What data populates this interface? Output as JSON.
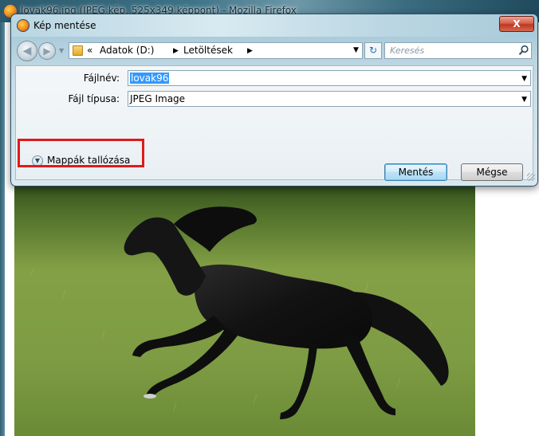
{
  "browser": {
    "title": "lovak96.jpg (JPEG kép, 525x349 képpont) - Mozilla Firefox",
    "icon": "firefox-icon"
  },
  "dialog": {
    "title": "Kép mentése",
    "close_label": "X",
    "nav": {
      "back_icon": "back-arrow-icon",
      "forward_icon": "forward-arrow-icon",
      "breadcrumb_prefix": "«",
      "breadcrumb": [
        "Adatok (D:)",
        "Letöltések"
      ],
      "refresh_icon": "refresh-icon"
    },
    "search": {
      "placeholder": "Keresés"
    },
    "form": {
      "filename_label": "Fájlnév:",
      "filename_value": "lovak96",
      "filetype_label": "Fájl típusa:",
      "filetype_value": "JPEG Image"
    },
    "browse_folders_label": "Mappák tallózása",
    "save_label": "Mentés",
    "cancel_label": "Mégse"
  },
  "colors": {
    "highlight_border": "#e01a1a",
    "selection": "#3399ff"
  }
}
